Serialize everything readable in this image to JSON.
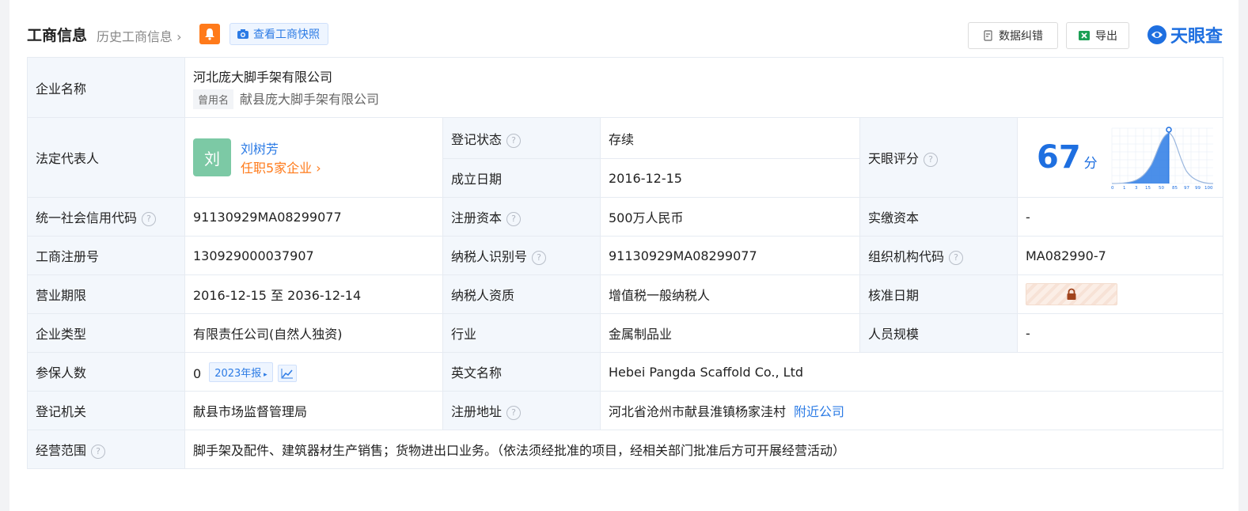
{
  "header": {
    "title": "工商信息",
    "history_link": "历史工商信息",
    "snapshot_button": "查看工商快照",
    "correction_button": "数据纠错",
    "export_button": "导出",
    "logo_text": "天眼查"
  },
  "company": {
    "name_label": "企业名称",
    "name": "河北庞大脚手架有限公司",
    "former_tag": "曾用名",
    "former_name": "献县庞大脚手架有限公司"
  },
  "legal_rep": {
    "label": "法定代表人",
    "avatar_char": "刘",
    "name": "刘树芳",
    "positions": "任职5家企业"
  },
  "status": {
    "label": "登记状态",
    "value": "存续"
  },
  "founded": {
    "label": "成立日期",
    "value": "2016-12-15"
  },
  "score": {
    "label": "天眼评分",
    "value": "67",
    "unit": "分"
  },
  "score_chart": {
    "ticks": [
      "0",
      "1",
      "3",
      "15",
      "50",
      "85",
      "97",
      "99",
      "100"
    ]
  },
  "credit_code": {
    "label": "统一社会信用代码",
    "value": "91130929MA08299077"
  },
  "reg_capital": {
    "label": "注册资本",
    "value": "500万人民币"
  },
  "paid_capital": {
    "label": "实缴资本",
    "value": "-"
  },
  "reg_number": {
    "label": "工商注册号",
    "value": "130929000037907"
  },
  "taxpayer_id": {
    "label": "纳税人识别号",
    "value": "91130929MA08299077"
  },
  "org_code": {
    "label": "组织机构代码",
    "value": "MA082990-7"
  },
  "term": {
    "label": "营业期限",
    "value": "2016-12-15 至 2036-12-14"
  },
  "taxpayer_qual": {
    "label": "纳税人资质",
    "value": "增值税一般纳税人"
  },
  "approval_date": {
    "label": "核准日期"
  },
  "company_type": {
    "label": "企业类型",
    "value": "有限责任公司(自然人独资)"
  },
  "industry": {
    "label": "行业",
    "value": "金属制品业"
  },
  "staff_size": {
    "label": "人员规模",
    "value": "-"
  },
  "insured": {
    "label": "参保人数",
    "value": "0",
    "report": "2023年报"
  },
  "english_name": {
    "label": "英文名称",
    "value": "Hebei Pangda Scaffold Co., Ltd"
  },
  "authority": {
    "label": "登记机关",
    "value": "献县市场监督管理局"
  },
  "address": {
    "label": "注册地址",
    "value": "河北省沧州市献县淮镇杨家洼村",
    "nearby": "附近公司"
  },
  "scope": {
    "label": "经营范围",
    "value": "脚手架及配件、建筑器材生产销售；货物进出口业务。（依法须经批准的项目，经相关部门批准后方可开展经营活动）"
  },
  "colors": {
    "accent": "#1e6fe0",
    "status_green": "#18a058",
    "orange": "#ff7a1a",
    "label_bg": "#f3f7fc"
  }
}
